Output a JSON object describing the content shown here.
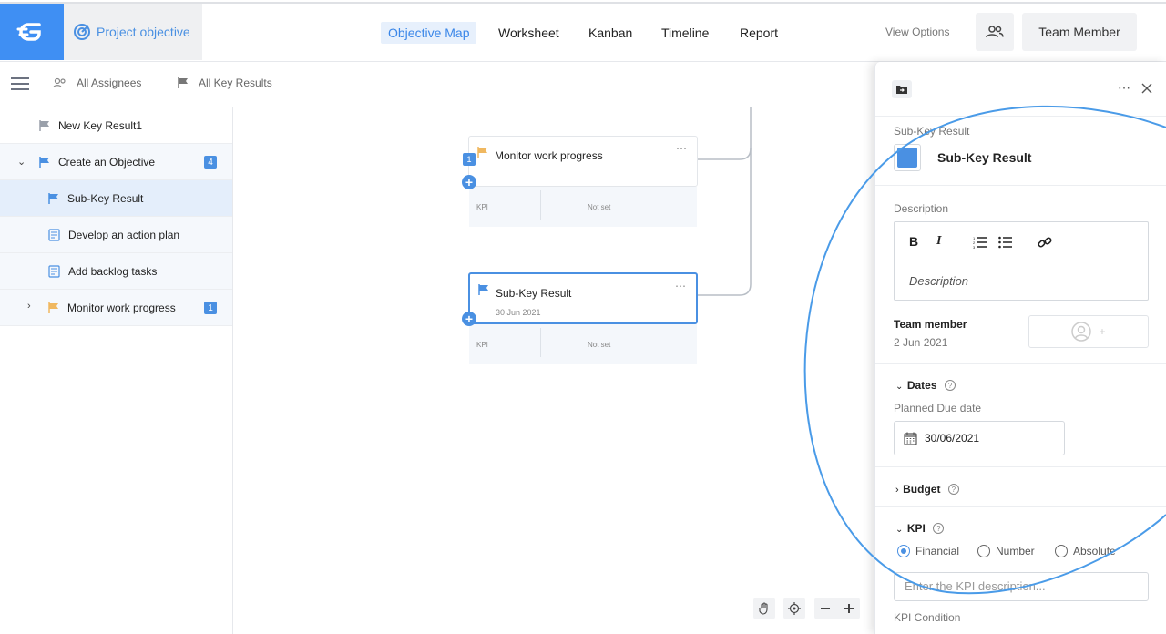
{
  "header": {
    "project_title": "Project objective",
    "tabs": [
      {
        "label": "Objective Map",
        "active": true
      },
      {
        "label": "Worksheet"
      },
      {
        "label": "Kanban"
      },
      {
        "label": "Timeline"
      },
      {
        "label": "Report"
      }
    ],
    "view_options": "View Options",
    "team_member_button": "Team Member"
  },
  "filters": {
    "assignees": "All Assignees",
    "key_results": "All Key Results"
  },
  "sidebar": {
    "items": [
      {
        "label": "New Key Result1",
        "icon": "flag-icon",
        "color": "#9aa0aa"
      },
      {
        "label": "Create an Objective",
        "icon": "flag-icon",
        "color": "#4a90e2",
        "badge": "4",
        "expanded": true
      },
      {
        "label": "Sub-Key Result",
        "icon": "flag-icon",
        "color": "#4a90e2",
        "selected": true
      },
      {
        "label": "Develop an action plan",
        "icon": "task-icon"
      },
      {
        "label": "Add backlog tasks",
        "icon": "task-icon"
      },
      {
        "label": "Monitor work progress",
        "icon": "flag-icon",
        "color": "#f0b860",
        "badge": "1",
        "expanded": false
      }
    ]
  },
  "canvas": {
    "nodes": [
      {
        "title": "Monitor work progress",
        "badge": "1",
        "kpi_label": "KPI",
        "kpi_value": "Not set",
        "flag_color": "#f0b860"
      },
      {
        "title": "Sub-Key Result",
        "date": "30 Jun 2021",
        "kpi_label": "KPI",
        "kpi_value": "Not set",
        "flag_color": "#4a90e2"
      }
    ]
  },
  "panel": {
    "type_label": "Sub-Key Result",
    "title": "Sub-Key Result",
    "color": "#4a90e2",
    "description_label": "Description",
    "description_placeholder": "Description",
    "team_member_label": "Team member",
    "team_member_date": "2 Jun 2021",
    "dates_label": "Dates",
    "planned_due_label": "Planned Due date",
    "planned_due_value": "30/06/2021",
    "budget_label": "Budget",
    "kpi_label": "KPI",
    "kpi_options": [
      "Financial",
      "Number",
      "Absolute"
    ],
    "kpi_selected": "Financial",
    "kpi_placeholder": "Enter the KPI description...",
    "kpi_condition_label": "KPI Condition"
  },
  "colors": {
    "accent": "#4a90e2",
    "logo_bg": "#3f8ff3"
  }
}
